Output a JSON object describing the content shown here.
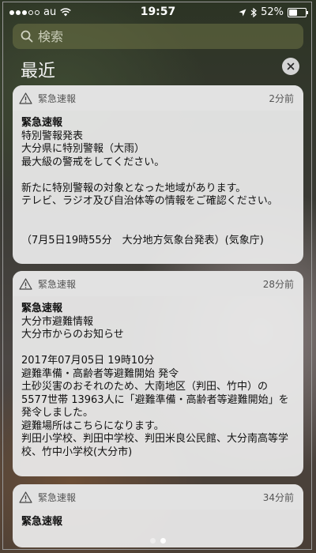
{
  "status_bar": {
    "carrier": "au",
    "time": "19:57",
    "battery": "52%",
    "battery_level": 0.52,
    "signal_dots_filled": 3,
    "signal_dots_total": 5
  },
  "search": {
    "placeholder": "検索"
  },
  "section": {
    "title": "最近"
  },
  "notifications": [
    {
      "app": "緊急速報",
      "time": "2分前",
      "title": "緊急速報",
      "lines": [
        "特別警報発表",
        "大分県に特別警報（大雨）",
        "最大級の警戒をしてください。",
        "",
        "新たに特別警報の対象となった地域があります。",
        "テレビ、ラジオ及び自治体等の情報をご確認ください。",
        "",
        "",
        "（7月5日19時55分　大分地方気象台発表）(気象庁)"
      ]
    },
    {
      "app": "緊急速報",
      "time": "28分前",
      "title": "緊急速報",
      "lines": [
        "大分市避難情報",
        "大分市からのお知らせ",
        "",
        "2017年07月05日 19時10分",
        "避難準備・高齢者等避難開始 発令",
        "土砂災害のおそれのため、大南地区（判田、竹中）の",
        "5577世帯 13963人に「避難準備・高齢者等避難開始」を",
        "発令しました。",
        "避難場所はこちらになります。",
        "判田小学校、判田中学校、判田米良公民館、大分南高等学",
        "校、竹中小学校(大分市)"
      ]
    },
    {
      "app": "緊急速報",
      "time": "34分前",
      "title": "緊急速報",
      "lines": []
    }
  ],
  "pager": {
    "pages": 2,
    "current": 2
  },
  "colors": {
    "card_bg": "#ececec",
    "status_text": "#ffffff"
  }
}
